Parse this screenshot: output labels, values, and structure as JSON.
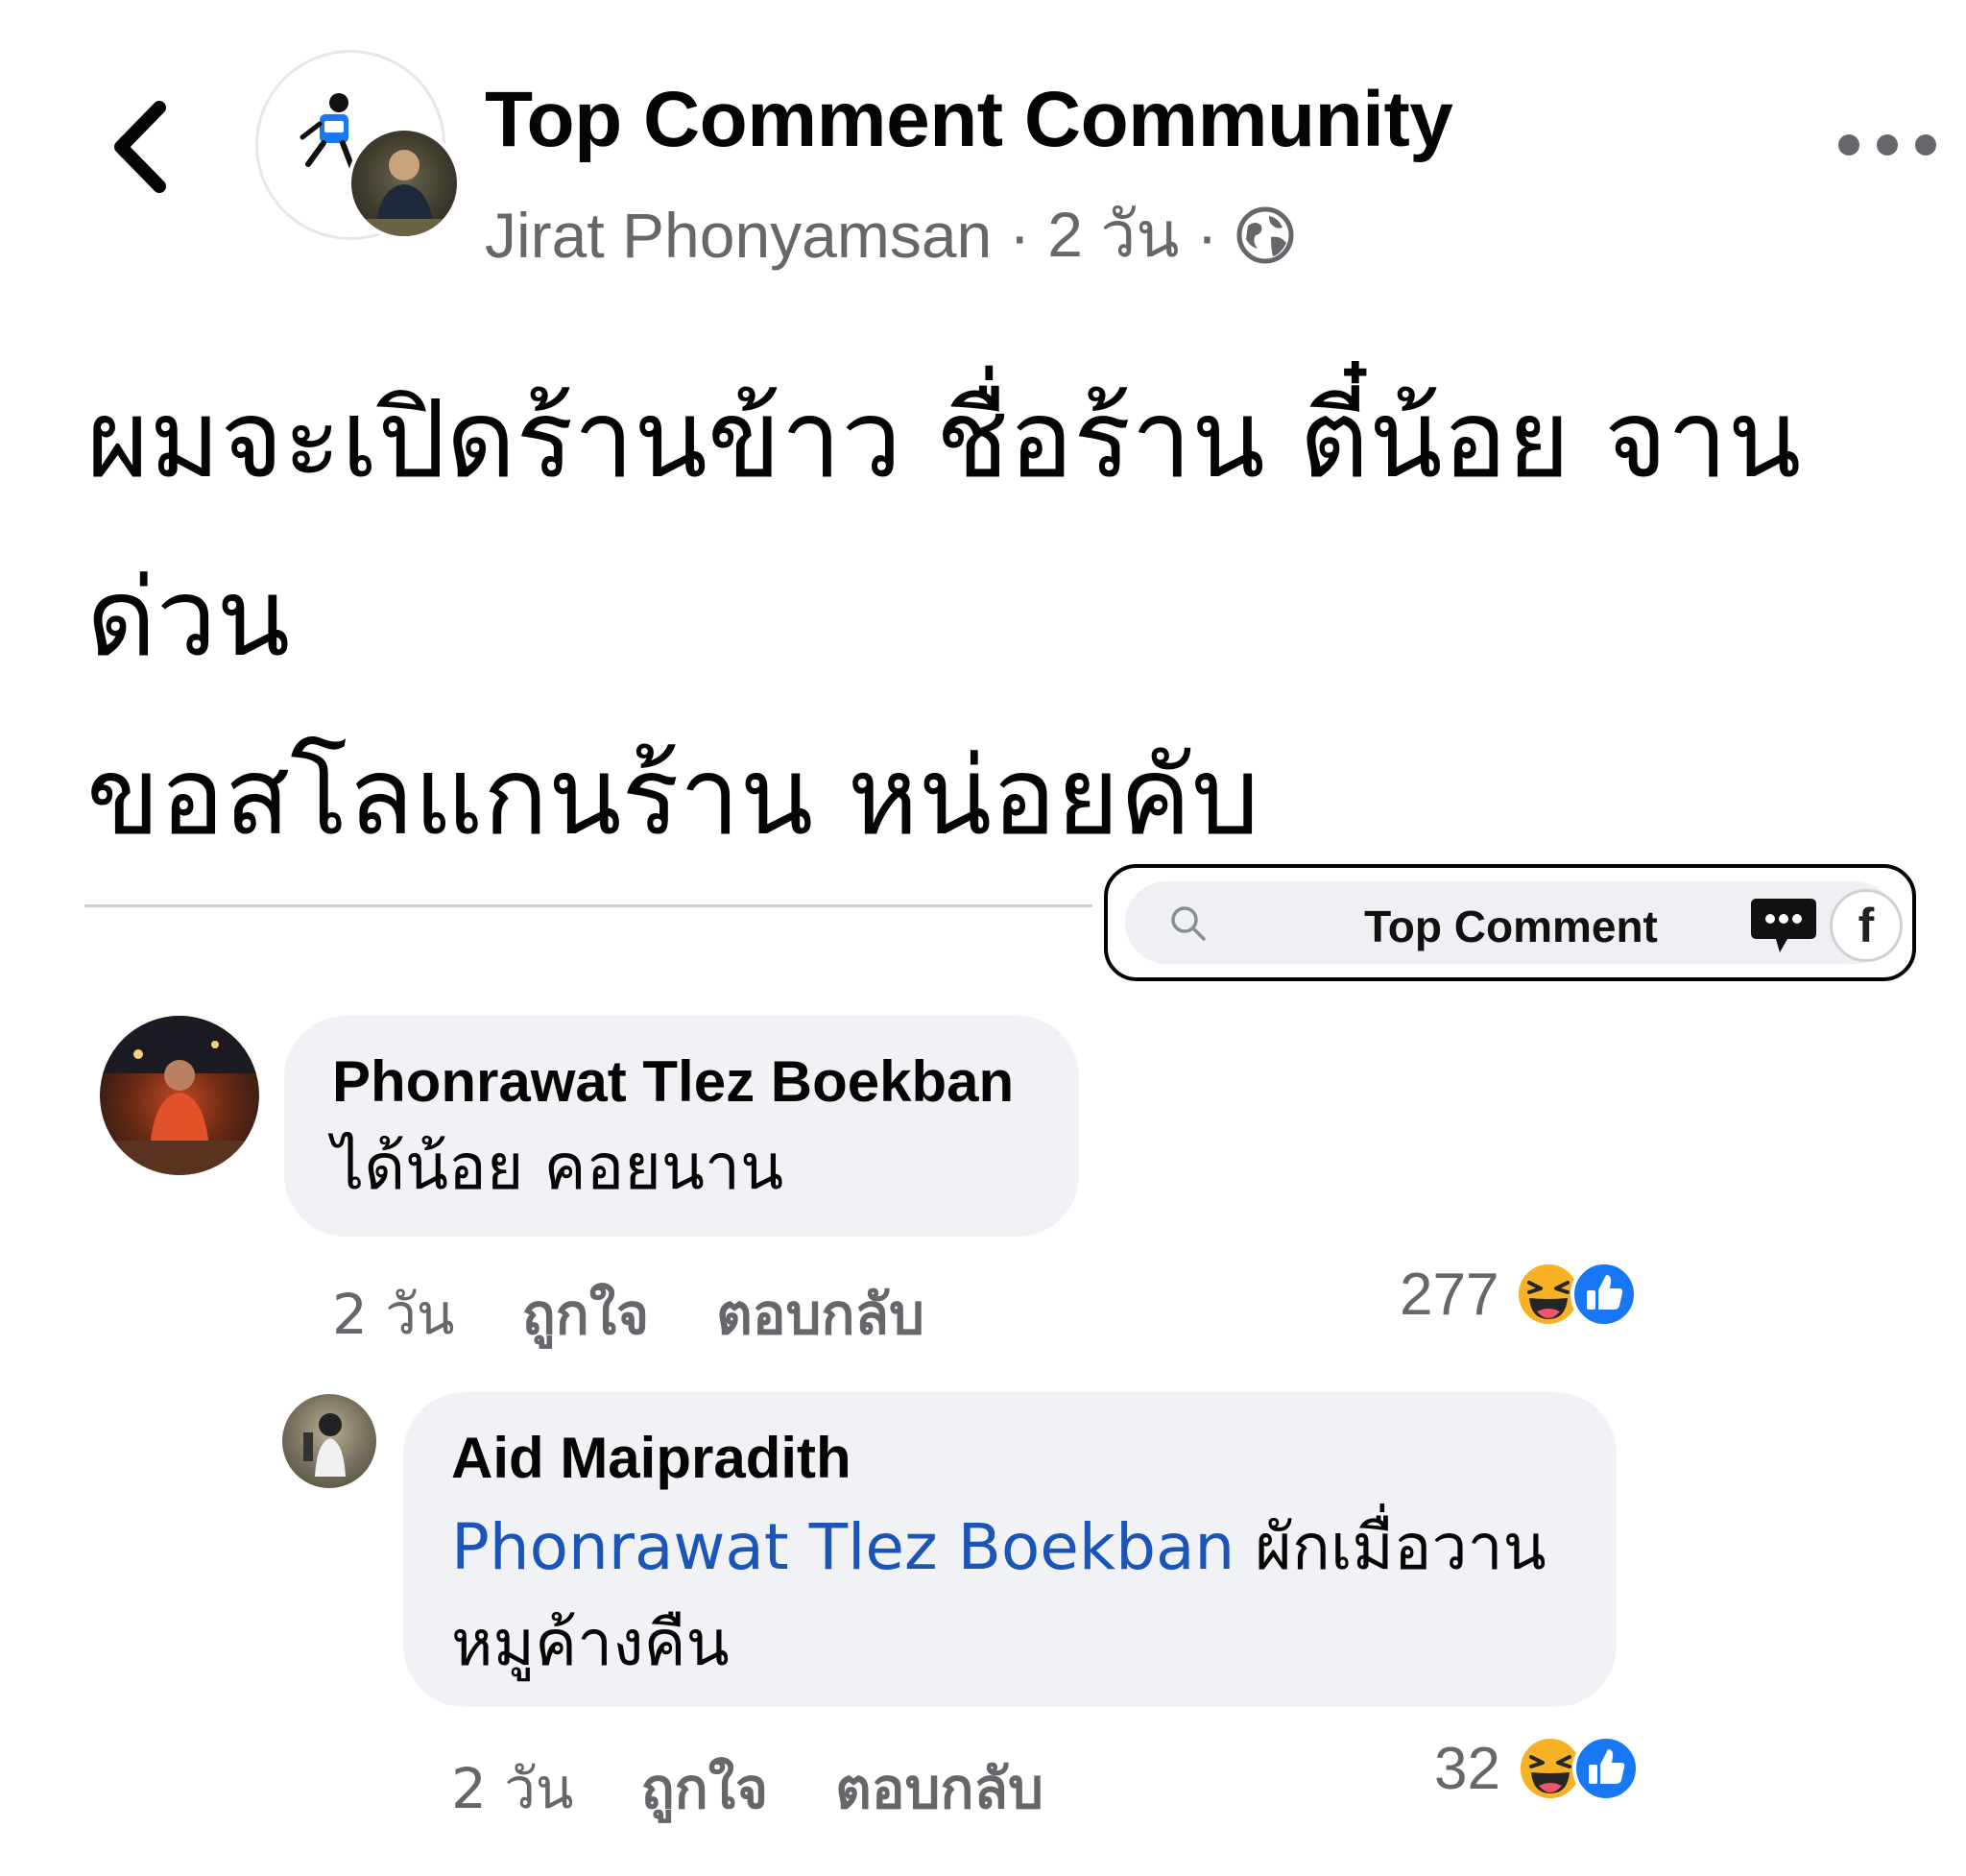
{
  "header": {
    "group_name": "Top Comment Community",
    "poster_name": "Jirat Phonyamsan",
    "separator": "·",
    "time": "2 วัน"
  },
  "post": {
    "lines": [
      "ผมจะเปิดร้านข้าว ชื่อร้าน ตี๋น้อย จาน",
      "ด่วน",
      "ขอสโลแกนร้าน หน่อยคับ"
    ]
  },
  "watermark": {
    "text": "Top Comment",
    "fb_letter": "f"
  },
  "comments": [
    {
      "author": "Phonrawat Tlez Boekban",
      "text": "ได้น้อย คอยนาน",
      "time": "2 วัน",
      "like_label": "ถูกใจ",
      "reply_label": "ตอบกลับ",
      "reaction_count": "277"
    },
    {
      "author": "Aid Maipradith",
      "mention": "Phonrawat Tlez Boekban",
      "text_after_mention": " ผักเมื่อวาน",
      "text_line2": "หมูค้างคืน",
      "time": "2 วัน",
      "like_label": "ถูกใจ",
      "reply_label": "ตอบกลับ",
      "reaction_count": "32"
    }
  ],
  "colors": {
    "mention": "#1c55b8",
    "like_blue": "#1877f2",
    "haha_yellow": "#f7b125",
    "bubble": "#f0f2f5",
    "meta_gray": "#65676b"
  },
  "icons": [
    "back-chevron-icon",
    "globe-icon",
    "more-dots-icon",
    "search-icon",
    "chat-bubble-icon",
    "facebook-icon",
    "haha-reaction-icon",
    "like-reaction-icon"
  ]
}
